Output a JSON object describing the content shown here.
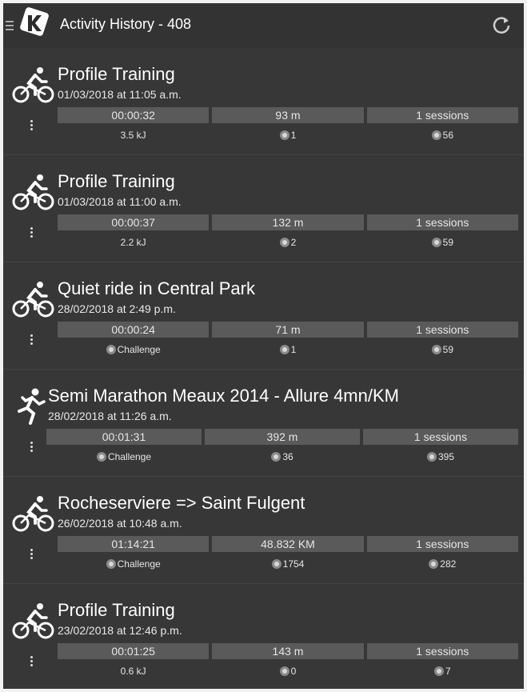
{
  "header": {
    "title": "Activity History - 408"
  },
  "activities": [
    {
      "type": "bike",
      "name": "Profile Training",
      "date": "01/03/2018 at 11:05 a.m.",
      "duration": "00:00:32",
      "distance": "93 m",
      "sessions": "1 sessions",
      "energy": "3.5 kJ",
      "stat2": "1",
      "stat3": "56"
    },
    {
      "type": "bike",
      "name": "Profile Training",
      "date": "01/03/2018 at 11:00 a.m.",
      "duration": "00:00:37",
      "distance": "132 m",
      "sessions": "1 sessions",
      "energy": "2.2 kJ",
      "stat2": "2",
      "stat3": "59"
    },
    {
      "type": "bike",
      "name": "Quiet ride in Central Park",
      "date": "28/02/2018 at 2:49 p.m.",
      "duration": "00:00:24",
      "distance": "71 m",
      "sessions": "1 sessions",
      "energy": "Challenge",
      "stat2": "1",
      "stat3": "59"
    },
    {
      "type": "run",
      "name": "Semi Marathon Meaux 2014 - Allure 4mn/KM",
      "date": "28/02/2018 at 11:26 a.m.",
      "duration": "00:01:31",
      "distance": "392 m",
      "sessions": "1 sessions",
      "energy": "Challenge",
      "stat2": "36",
      "stat3": "395"
    },
    {
      "type": "bike",
      "name": "Rocheserviere => Saint Fulgent",
      "date": "26/02/2018 at 10:48 a.m.",
      "duration": "01:14:21",
      "distance": "48.832 KM",
      "sessions": "1 sessions",
      "energy": "Challenge",
      "stat2": "1754",
      "stat3": "282"
    },
    {
      "type": "bike",
      "name": "Profile Training",
      "date": "23/02/2018 at 12:46 p.m.",
      "duration": "00:01:25",
      "distance": "143 m",
      "sessions": "1 sessions",
      "energy": "0.6 kJ",
      "stat2": "0",
      "stat3": "7"
    }
  ]
}
